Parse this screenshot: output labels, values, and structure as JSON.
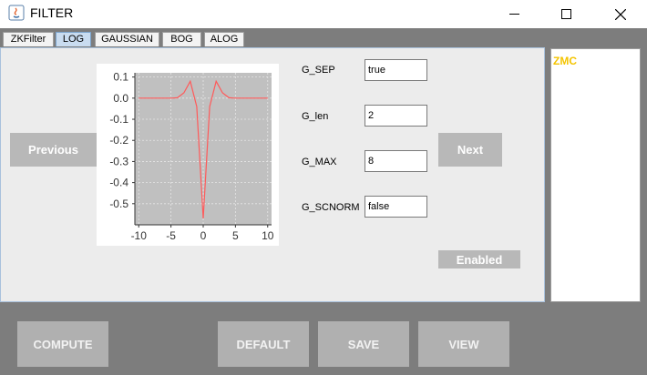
{
  "window": {
    "title": "FILTER"
  },
  "tabs": [
    {
      "label": "ZKFilter",
      "active": false
    },
    {
      "label": "LOG",
      "active": true
    },
    {
      "label": "GAUSSIAN",
      "active": false
    },
    {
      "label": "BOG",
      "active": false
    },
    {
      "label": "ALOG",
      "active": false
    }
  ],
  "nav": {
    "previous_label": "Previous",
    "next_label": "Next",
    "enabled_label": "Enabled"
  },
  "fields": [
    {
      "label": "G_SEP",
      "value": "true"
    },
    {
      "label": "G_len",
      "value": "2"
    },
    {
      "label": "G_MAX",
      "value": "8"
    },
    {
      "label": "G_SCNORM",
      "value": "false"
    }
  ],
  "side_panel": {
    "label": "ZMC"
  },
  "bottom": {
    "compute_label": "COMPUTE",
    "default_label": "DEFAULT",
    "save_label": "SAVE",
    "view_label": "VIEW"
  },
  "colors": {
    "chart_bg": "#c0c0c0",
    "line": "#ff5a5a",
    "side_label": "#f4c400",
    "tab_active": "#c9dcf0"
  },
  "chart_data": {
    "type": "line",
    "title": "",
    "xlabel": "",
    "ylabel": "",
    "xlim": [
      -10.6,
      10.6
    ],
    "ylim": [
      -0.6,
      0.12
    ],
    "xticks": [
      "-10",
      "-5",
      "0",
      "5",
      "10"
    ],
    "xtick_values": [
      -10,
      -5,
      0,
      5,
      10
    ],
    "yticks": [
      "0.1",
      "0.0",
      "-0.1",
      "-0.2",
      "-0.3",
      "-0.4",
      "-0.5"
    ],
    "ytick_values": [
      0.1,
      0.0,
      -0.1,
      -0.2,
      -0.3,
      -0.4,
      -0.5
    ],
    "grid": true,
    "series": [
      {
        "x": [
          -10,
          -9,
          -8,
          -7,
          -6,
          -5,
          -4,
          -3,
          -2,
          -1,
          0,
          1,
          2,
          3,
          4,
          5,
          6,
          7,
          8,
          9,
          10
        ],
        "y": [
          0,
          0,
          0,
          0,
          0,
          0,
          0.002,
          0.025,
          0.08,
          -0.04,
          -0.57,
          -0.04,
          0.08,
          0.025,
          0.002,
          0,
          0,
          0,
          0,
          0,
          0
        ]
      }
    ]
  }
}
